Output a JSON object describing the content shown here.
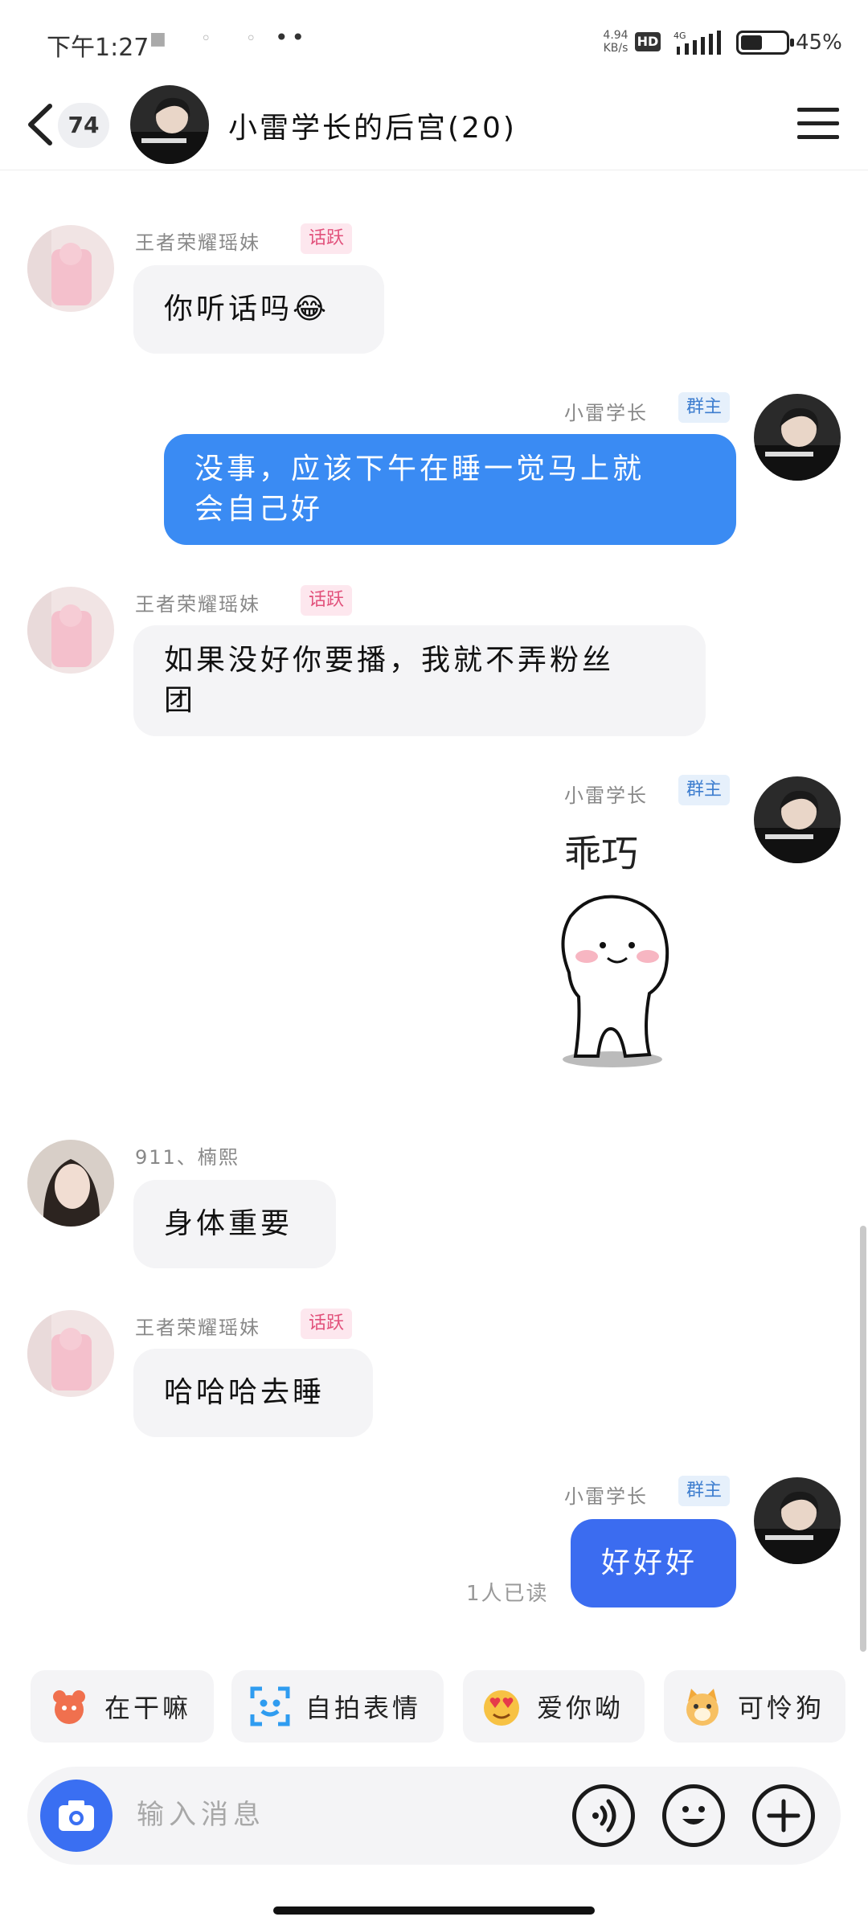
{
  "status_bar": {
    "time": "下午1:27",
    "net_speed": "4.94 KB/s",
    "hd": "HD",
    "network": "4G",
    "battery": "45%"
  },
  "header": {
    "unread_count": "74",
    "group_title": "小雷学长的后宫(20)"
  },
  "messages": [
    {
      "sender": "王者荣耀瑶妹",
      "tag": "话跃",
      "text": "你听话吗😂"
    },
    {
      "sender": "小雷学长",
      "tag": "群主",
      "text_line1": "没事，应该下午在睡一觉马上就",
      "text_line2": "会自己好"
    },
    {
      "sender": "王者荣耀瑶妹",
      "tag": "话跃",
      "text_line1": "如果没好你要播，我就不弄粉丝",
      "text_line2": "团"
    },
    {
      "sender": "小雷学长",
      "tag": "群主",
      "sticker_caption": "乖巧"
    },
    {
      "sender": "911、楠熙",
      "text": "身体重要"
    },
    {
      "sender": "王者荣耀瑶妹",
      "tag": "话跃",
      "text": "哈哈哈去睡"
    },
    {
      "sender": "小雷学长",
      "tag": "群主",
      "text": "好好好",
      "read_receipt": "1人已读"
    }
  ],
  "quick_replies": [
    {
      "label": "在干嘛",
      "icon": "bear-icon"
    },
    {
      "label": "自拍表情",
      "icon": "face-scan-icon"
    },
    {
      "label": "爱你呦",
      "icon": "heart-eyes-icon"
    },
    {
      "label": "可怜狗",
      "icon": "dog-icon"
    }
  ],
  "input": {
    "placeholder": "输入消息"
  },
  "colors": {
    "bubble_out": "#3a8bf3",
    "bubble_out_last": "#3b6cf0",
    "bubble_in": "#f4f4f6",
    "camera_button": "#3a6ff2",
    "tag_pink": "#e2527c",
    "tag_blue": "#3e7ecf"
  }
}
